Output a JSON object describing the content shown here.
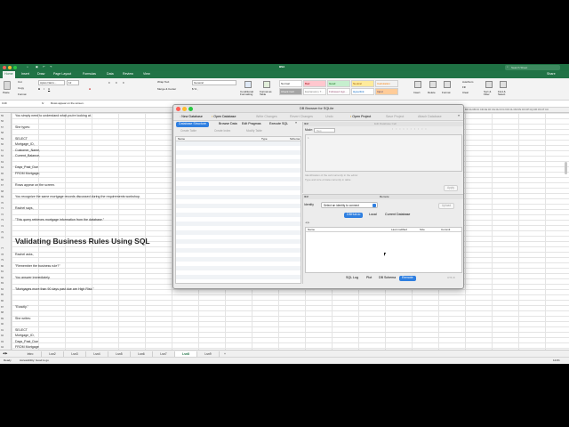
{
  "excel": {
    "title": "BSA",
    "search_placeholder": "Search Sheet",
    "tabs": [
      "Home",
      "Insert",
      "Draw",
      "Page Layout",
      "Formulas",
      "Data",
      "Review",
      "View"
    ],
    "share_label": "Share",
    "ribbon": {
      "paste": "Paste",
      "cut": "Cut",
      "copy": "Copy",
      "format": "Format",
      "font_name": "Aptos Narro...",
      "font_size": "12",
      "wrap_text": "Wrap Text",
      "merge_center": "Merge & Center",
      "number_format": "General",
      "conditional_formatting": "Conditional Formatting",
      "format_as_table": "Format as Table",
      "styles": [
        {
          "label": "Normal",
          "bg": "#ffffff",
          "fg": "#222222"
        },
        {
          "label": "Bad",
          "bg": "#ffc7ce",
          "fg": "#9c0006"
        },
        {
          "label": "Good",
          "bg": "#c6efce",
          "fg": "#006100"
        },
        {
          "label": "Neutral",
          "bg": "#ffeb9c",
          "fg": "#9c5700"
        },
        {
          "label": "Calculation",
          "bg": "#f2f2f2",
          "fg": "#fa7d00"
        },
        {
          "label": "Check Cell",
          "bg": "#a5a5a5",
          "fg": "#ffffff"
        },
        {
          "label": "Explanatory T...",
          "bg": "#ffffff",
          "fg": "#7f7f7f"
        },
        {
          "label": "Followed Hyp...",
          "bg": "#ffffff",
          "fg": "#954f72"
        },
        {
          "label": "Hyperlink",
          "bg": "#ffffff",
          "fg": "#0563c1"
        },
        {
          "label": "Input",
          "bg": "#ffcc99",
          "fg": "#3f3f76"
        }
      ],
      "insert": "Insert",
      "delete": "Delete",
      "format_cells": "Format",
      "autosum": "AutoSum",
      "fill": "Fill",
      "clear": "Clear",
      "sort_filter": "Sort & Filter",
      "find_select": "Find & Select"
    },
    "name_box": "C49",
    "fx": "fx",
    "formula_value": "Rows appear on the screen.",
    "col_header_right": "BZ CA CB CC CD CE CF CG CH CI CJ CK CL CM CN CO CP CQ CR CS CT CU",
    "rows": [
      {
        "n": "55",
        "text": "You simply need to understand what you're looking at."
      },
      {
        "n": "56",
        "text": ""
      },
      {
        "n": "57",
        "text": "She types:"
      },
      {
        "n": "58",
        "text": ""
      },
      {
        "n": "59",
        "text": "SELECT"
      },
      {
        "n": "60",
        "text": "Mortgage_ID,"
      },
      {
        "n": "61",
        "text": "Customer_Name,"
      },
      {
        "n": "62",
        "text": "Current_Balance,"
      },
      {
        "n": "63",
        "text": ""
      },
      {
        "n": "64",
        "text": "Days_Past_Due"
      },
      {
        "n": "65",
        "text": "FROM Mortgage;"
      },
      {
        "n": "66",
        "text": ""
      },
      {
        "n": "67",
        "text": "Rows appear on the screen."
      },
      {
        "n": "68",
        "text": ""
      },
      {
        "n": "69",
        "text": "You recognize the same mortgage records discussed during the requirements workshop."
      },
      {
        "n": "70",
        "text": ""
      },
      {
        "n": "71",
        "text": "Rachel says,"
      },
      {
        "n": "72",
        "text": ""
      },
      {
        "n": "73",
        "text": "\"This query retrieves mortgage information from the database.\""
      },
      {
        "n": "74",
        "text": ""
      },
      {
        "n": "75",
        "text": ""
      },
      {
        "n": "76",
        "text": "Validating Business Rules Using SQL",
        "heading": true
      },
      {
        "n": "77",
        "text": ""
      },
      {
        "n": "78",
        "text": "Rachel asks,"
      },
      {
        "n": "79",
        "text": ""
      },
      {
        "n": "80",
        "text": "\"Remember the business rule?\""
      },
      {
        "n": "81",
        "text": ""
      },
      {
        "n": "82",
        "text": "You answer immediately."
      },
      {
        "n": "83",
        "text": ""
      },
      {
        "n": "84",
        "text": "\"Mortgages more than 90 days past due are High Risk.\""
      },
      {
        "n": "85",
        "text": ""
      },
      {
        "n": "86",
        "text": ""
      },
      {
        "n": "87",
        "text": "\"Exactly.\""
      },
      {
        "n": "88",
        "text": ""
      },
      {
        "n": "89",
        "text": "She writes:"
      },
      {
        "n": "90",
        "text": ""
      },
      {
        "n": "91",
        "text": "SELECT"
      },
      {
        "n": "92",
        "text": "Mortgage_ID,"
      },
      {
        "n": "93",
        "text": "Days_Past_Due"
      },
      {
        "n": "94",
        "text": "FROM Mortgage"
      }
    ],
    "sheet_tabs": [
      "Intro",
      "Lsn2",
      "Lsn3",
      "Lsn4",
      "Lsn5",
      "Lsn6",
      "Lsn7",
      "Lsn8",
      "Lsn9"
    ],
    "active_sheet": "Lsn8",
    "add_sheet": "+",
    "status_left": "Ready",
    "accessibility": "Accessibility: Good to go",
    "zoom": "121%"
  },
  "db": {
    "title": "DB Browser for SQLite",
    "toolbar": {
      "new_db": "New Database",
      "open_db": "Open Database",
      "write_changes": "Write Changes",
      "revert_changes": "Revert Changes",
      "undo": "Undo",
      "open_project": "Open Project",
      "save_project": "Save Project",
      "attach_db": "Attach Database"
    },
    "tabs": [
      "Database Structure",
      "Browse Data",
      "Edit Pragmas",
      "Execute SQL"
    ],
    "active_tab": "Database Structure",
    "structure_buttons": [
      "Create Table",
      "Create Index",
      "Modify Table"
    ],
    "tree_headers": [
      "Name",
      "Type",
      "Schema"
    ],
    "edit_cell": {
      "title": "Edit Database Cell",
      "mode_label": "Mode:",
      "mode_value": "Text",
      "line_no": "1",
      "hint1": "Identification of the cell currently in the editor",
      "hint2": "Type and size of data currently in table",
      "apply": "Apply"
    },
    "remote": {
      "title": "Remote",
      "identity_label": "Identity",
      "identity_value": "Select an identity to connect",
      "upload": "Upload",
      "tabs": [
        "DBHub.io",
        "Local",
        "Current Database"
      ],
      "active_tab": "DBHub.io",
      "headers": [
        "Name",
        "Last modified",
        "Size",
        "Commit"
      ]
    },
    "bottom_tabs": [
      "SQL Log",
      "Plot",
      "DB Schema",
      "Remote"
    ],
    "active_bottom": "Remote",
    "encoding": "UTF-8"
  }
}
